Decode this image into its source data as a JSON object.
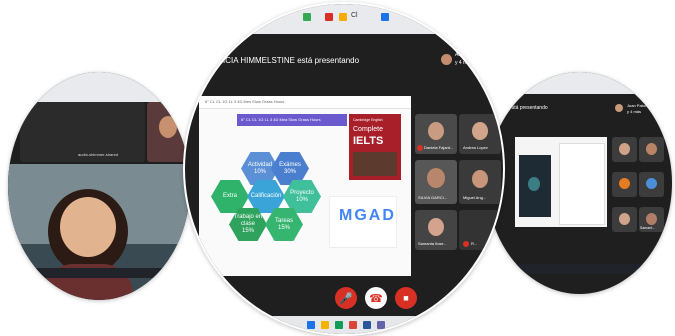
{
  "left_window": {
    "participant_label": "audio-shimmer-shared"
  },
  "center_window": {
    "tab_label": "Cl",
    "presenting_banner": "ICIA HIMMELSTINE está presentando",
    "presenter_short": "Andr",
    "others_count": "y 4 más",
    "slide": {
      "header_text": "6° CL CL 1G 1L 3 4D Mes Slow Grass Hours",
      "banner_text": "6° CL CL 1G 1L 3 4D Mea Slow Grass Hours",
      "book_title_top": "Cambridge English",
      "book_title_main": "Complete",
      "book_title_exam": "IELTS",
      "hexagons": [
        {
          "label": "Actividad",
          "value": "10%"
        },
        {
          "label": "Exámes",
          "value": "30%"
        },
        {
          "label": "Extra",
          "value": ""
        },
        {
          "label": "Calificación",
          "value": ""
        },
        {
          "label": "Proyecto",
          "value": "10%"
        },
        {
          "label": "Trabajo en clase",
          "value": "15%"
        },
        {
          "label": "Tareas",
          "value": "15%"
        }
      ],
      "logo_letters": "MGAD"
    },
    "participants": [
      {
        "name": "Daniela Fajard..."
      },
      {
        "name": "Andrea Lopez"
      },
      {
        "name": "SILVIA GARCI..."
      },
      {
        "name": "Miguel Ang..."
      },
      {
        "name": "Samanta Ibarr..."
      },
      {
        "name": "R..."
      }
    ]
  },
  "right_window": {
    "presenting_banner": "está presentando",
    "presenter_short": "Juan Pabo",
    "others_count": "y 4 más",
    "participant_label": "Samant..."
  }
}
